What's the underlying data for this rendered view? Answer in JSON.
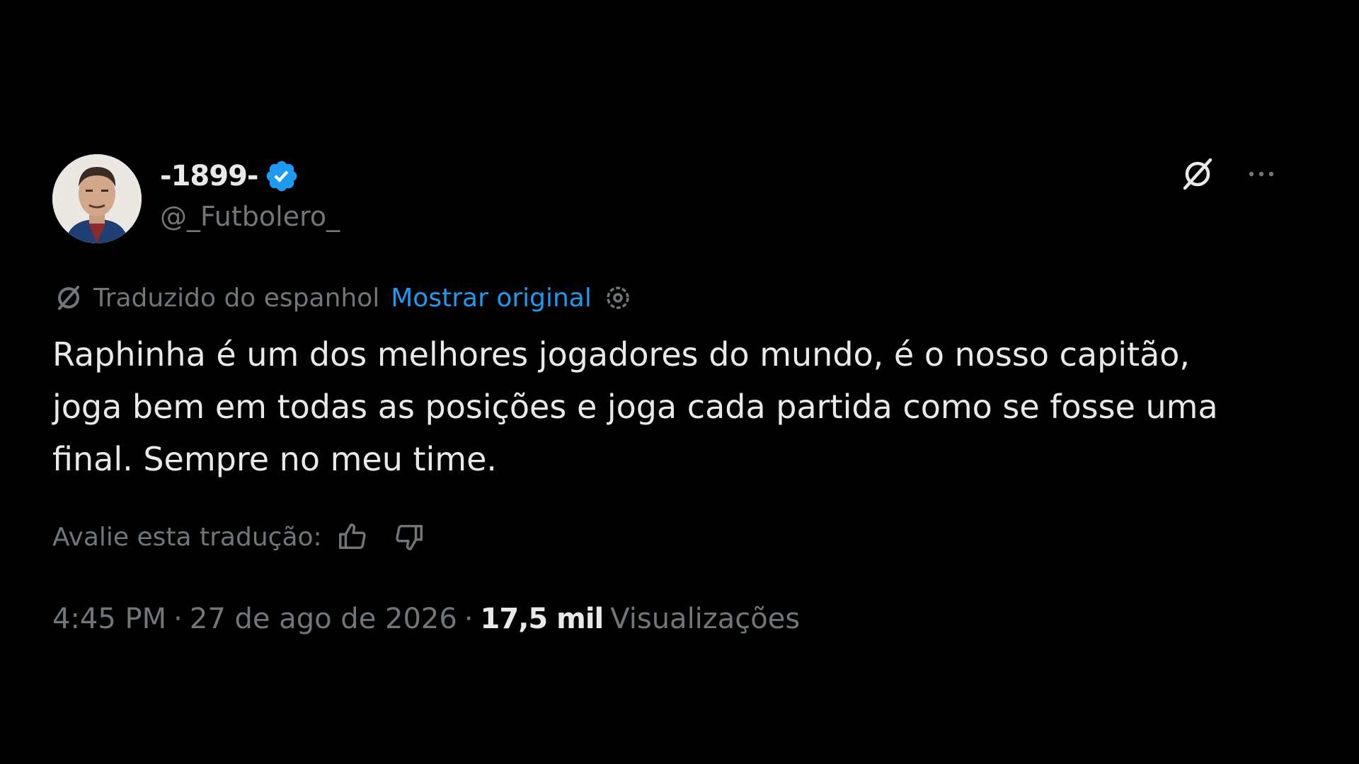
{
  "author": {
    "display_name": "-1899-",
    "handle": "@_Futbolero_",
    "verified": true,
    "verified_color": "#1d9bf0"
  },
  "translation": {
    "label": "Traduzido do espanhol",
    "show_original": "Mostrar original"
  },
  "tweet": {
    "text_line_1": "Raphinha é um dos melhores jogadores do mundo, é o nosso capitão,",
    "text_line_2": "joga bem em todas as posições e joga cada partida como se fosse uma",
    "text_line_3": "final. Sempre no meu time."
  },
  "rating": {
    "label": "Avalie esta tradução:"
  },
  "meta": {
    "time": "4:45 PM",
    "separator": "·",
    "date": "27 de ago de 2026",
    "views_count": "17,5 mil",
    "views_label": "Visualizações"
  },
  "icons": {
    "grok": "grok-icon",
    "more": "more-icon",
    "translate": "translate-icon",
    "settings": "settings-icon",
    "thumb_up": "thumbs-up-icon",
    "thumb_down": "thumbs-down-icon"
  },
  "colors": {
    "background": "#000000",
    "text_primary": "#e7e9ea",
    "text_secondary": "#71767b",
    "accent": "#1d9bf0"
  }
}
